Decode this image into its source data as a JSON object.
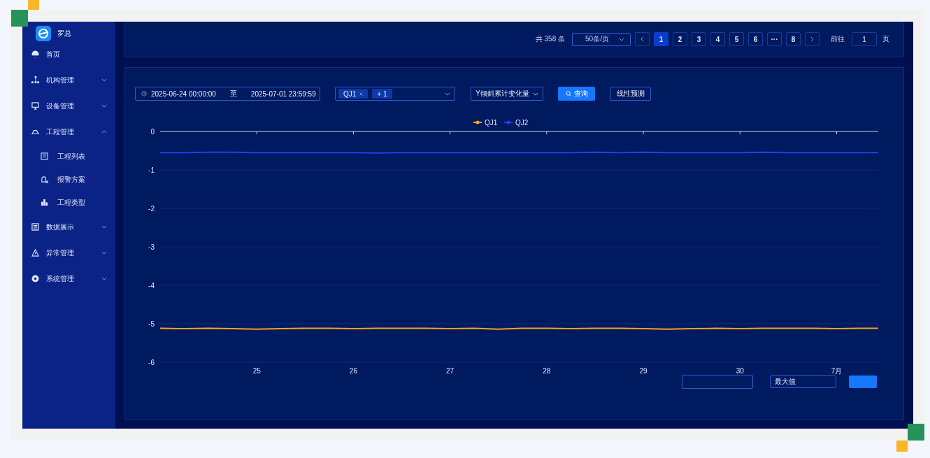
{
  "sidebar": {
    "user": "罗总",
    "items": [
      {
        "label": "首页"
      },
      {
        "label": "机构管理",
        "expanded": false
      },
      {
        "label": "设备管理",
        "expanded": false
      },
      {
        "label": "工程管理",
        "expanded": true,
        "children": [
          {
            "label": "工程列表"
          },
          {
            "label": "报警方案"
          },
          {
            "label": "工程类型"
          }
        ]
      },
      {
        "label": "数据展示",
        "expanded": false
      },
      {
        "label": "异常管理",
        "expanded": false
      },
      {
        "label": "系统管理",
        "expanded": false
      }
    ]
  },
  "pagination": {
    "total": "共 358 条",
    "page_size": "50条/页",
    "pages": [
      {
        "label": "1",
        "selected": true
      },
      {
        "label": "2",
        "selected": false
      },
      {
        "label": "3",
        "selected": false
      },
      {
        "label": "4",
        "selected": false
      },
      {
        "label": "5",
        "selected": false
      },
      {
        "label": "6",
        "selected": false
      },
      {
        "label": "···",
        "selected": false
      },
      {
        "label": "8",
        "selected": false
      }
    ],
    "goto_label": "前往",
    "goto_value": "1",
    "goto_suffix": "页"
  },
  "filters": {
    "date_start": "2025-06-24 00:00:00",
    "date_separator": "至",
    "date_end": "2025-07-01 23:59:59",
    "tags": [
      {
        "label": "QJ1",
        "closable": true
      },
      {
        "label": "+ 1",
        "closable": false
      }
    ],
    "metric": "Y倾斜累计变化量",
    "query_button": "查询",
    "predict_button": "线性预测"
  },
  "chart": {
    "chart_data": {
      "type": "line",
      "grid": true,
      "legend": true,
      "x": [
        "2025-06-24 00:00",
        "2025-06-24 06:00",
        "2025-06-24 12:00",
        "2025-06-24 18:00",
        "2025-06-25 00:00",
        "2025-06-25 06:00",
        "2025-06-25 12:00",
        "2025-06-25 18:00",
        "2025-06-26 00:00",
        "2025-06-26 06:00",
        "2025-06-26 12:00",
        "2025-06-26 18:00",
        "2025-06-27 00:00",
        "2025-06-27 06:00",
        "2025-06-27 12:00",
        "2025-06-27 18:00",
        "2025-06-28 00:00",
        "2025-06-28 06:00",
        "2025-06-28 12:00",
        "2025-06-28 18:00",
        "2025-06-29 00:00",
        "2025-06-29 06:00",
        "2025-06-29 12:00",
        "2025-06-29 18:00",
        "2025-06-30 00:00",
        "2025-06-30 06:00",
        "2025-06-30 12:00",
        "2025-06-30 18:00",
        "2025-07-01 00:00",
        "2025-07-01 06:00",
        "2025-07-01 10:20"
      ],
      "series": [
        {
          "name": "QJ1",
          "color": "#f0a818",
          "values": [
            -5.12,
            -5.13,
            -5.12,
            -5.13,
            -5.14,
            -5.13,
            -5.12,
            -5.12,
            -5.13,
            -5.12,
            -5.12,
            -5.12,
            -5.13,
            -5.12,
            -5.14,
            -5.12,
            -5.12,
            -5.13,
            -5.12,
            -5.12,
            -5.13,
            -5.14,
            -5.13,
            -5.12,
            -5.13,
            -5.12,
            -5.12,
            -5.12,
            -5.13,
            -5.12,
            -5.12
          ]
        },
        {
          "name": "QJ2",
          "color": "#1f3df0",
          "values": [
            -0.55,
            -0.55,
            -0.54,
            -0.54,
            -0.55,
            -0.55,
            -0.55,
            -0.55,
            -0.55,
            -0.56,
            -0.55,
            -0.55,
            -0.55,
            -0.55,
            -0.55,
            -0.55,
            -0.55,
            -0.55,
            -0.54,
            -0.55,
            -0.54,
            -0.55,
            -0.55,
            -0.55,
            -0.55,
            -0.54,
            -0.55,
            -0.55,
            -0.55,
            -0.55,
            -0.55
          ]
        }
      ],
      "xlim": [
        "2025-06-24 00:00",
        "2025-07-01 10:20"
      ],
      "ylim": [
        -6,
        0
      ],
      "xticks": [
        {
          "value": "2025-06-25 00:00",
          "label": "25"
        },
        {
          "value": "2025-06-26 00:00",
          "label": "26"
        },
        {
          "value": "2025-06-27 00:00",
          "label": "27"
        },
        {
          "value": "2025-06-28 00:00",
          "label": "28"
        },
        {
          "value": "2025-06-29 00:00",
          "label": "29"
        },
        {
          "value": "2025-06-30 00:00",
          "label": "30"
        },
        {
          "value": "2025-07-01 00:00",
          "label": "7月"
        }
      ],
      "yticks": [
        0,
        -1,
        -2,
        -3,
        -4,
        -5,
        -6
      ]
    }
  },
  "bottom_bar": {
    "select": "最大值"
  }
}
